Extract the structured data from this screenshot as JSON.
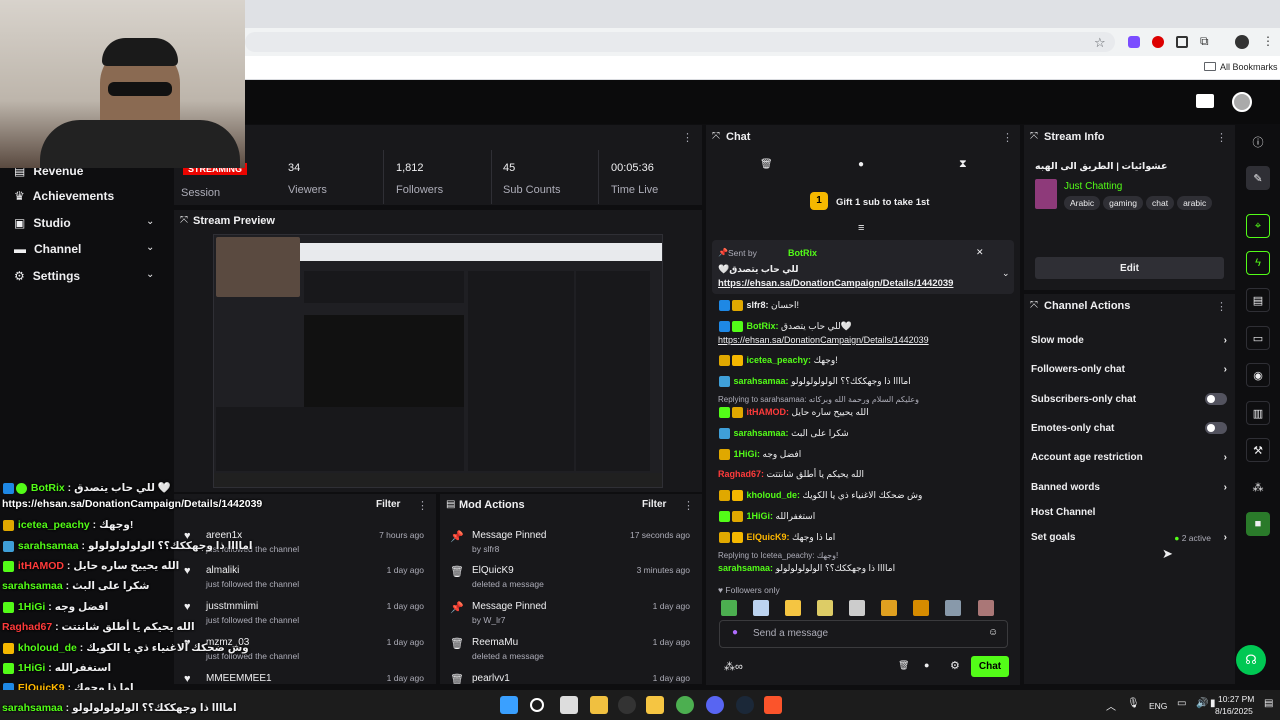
{
  "browser": {
    "all_bookmarks": "All Bookmarks"
  },
  "sidebar": {
    "items": [
      {
        "label": "Revenue"
      },
      {
        "label": "Achievements"
      },
      {
        "label": "Studio"
      },
      {
        "label": "Channel"
      },
      {
        "label": "Settings"
      }
    ]
  },
  "stats": {
    "badge": "STREAMING",
    "session_label": "Session",
    "viewers": {
      "value": "34",
      "label": "Viewers"
    },
    "followers": {
      "value": "1,812",
      "label": "Followers"
    },
    "subs": {
      "value": "45",
      "label": "Sub Counts"
    },
    "time": {
      "value": "00:05:36",
      "label": "Time Live"
    }
  },
  "stream_preview": {
    "title": "Stream Preview"
  },
  "activity": {
    "filter": "Filter",
    "items": [
      {
        "name": "areen1x",
        "sub": "just followed the channel",
        "time": "7 hours ago"
      },
      {
        "name": "almaliki",
        "sub": "just followed the channel",
        "time": "1 day ago"
      },
      {
        "name": "jusstmmiimi",
        "sub": "just followed the channel",
        "time": "1 day ago"
      },
      {
        "name": "mzmz_03",
        "sub": "just followed the channel",
        "time": "1 day ago"
      },
      {
        "name": "MMEEMMEE1",
        "sub": "",
        "time": "1 day ago"
      }
    ]
  },
  "mod_actions": {
    "title": "Mod Actions",
    "filter": "Filter",
    "items": [
      {
        "name": "Message Pinned",
        "sub": "by slfr8",
        "time": "17 seconds ago"
      },
      {
        "name": "ElQuicK9",
        "sub": "deleted a message",
        "time": "3 minutes ago"
      },
      {
        "name": "Message Pinned",
        "sub": "by W_lr7",
        "time": "1 day ago"
      },
      {
        "name": "ReemaMu",
        "sub": "deleted a message",
        "time": "1 day ago"
      },
      {
        "name": "pearlvv1",
        "sub": "",
        "time": "1 day ago"
      }
    ]
  },
  "chat": {
    "title": "Chat",
    "gift": "Gift 1 sub to take 1st",
    "pinned": {
      "sent_by": "Sent by",
      "user": "BotRix",
      "message": "للي حاب يتصدق🤍",
      "link": "https://ehsan.sa/DonationCampaign/Details/1442039"
    },
    "lines": [
      {
        "user": "slfr8:",
        "text": "احسان!",
        "color": "#efeff1"
      },
      {
        "user": "BotRix:",
        "text": "للي حاب يتصدق🤍",
        "color": "#53fc18"
      },
      {
        "user": "",
        "text": "https://ehsan.sa/DonationCampaign/Details/1442039",
        "color": "#efeff1"
      },
      {
        "user": "icetea_peachy:",
        "text": "وجهك!",
        "color": "#53fc18"
      },
      {
        "user": "sarahsamaa:",
        "text": "اماااا ذا وجهككك؟؟ الولولولولولو",
        "color": "#53fc18"
      },
      {
        "user": "",
        "text": "Replying to sarahsamaa: وعليكم السلام ورحمة الله وبركاته",
        "color": "#adadb8"
      },
      {
        "user": "itHAMOD:",
        "text": "الله يحييح ساره حايل",
        "color": "#ff3b3b"
      },
      {
        "user": "sarahsamaa:",
        "text": "شكرا على البث",
        "color": "#53fc18"
      },
      {
        "user": "1HiGi:",
        "text": "افضل وجه",
        "color": "#53fc18"
      },
      {
        "user": "Raghad67:",
        "text": "الله يحيكم يا أطلق شانتتت",
        "color": "#ff3b3b"
      },
      {
        "user": "kholoud_de:",
        "text": "وش ضحكك الاغنياء ذي يا الكويك",
        "color": "#53fc18"
      },
      {
        "user": "1HiGi:",
        "text": "استغفرالله",
        "color": "#53fc18"
      },
      {
        "user": "ElQuicK9:",
        "text": "اما ذا وجهك",
        "color": "#ffb800"
      },
      {
        "user": "",
        "text": "Replying to Icetea_peachy: وجهك!",
        "color": "#adadb8"
      },
      {
        "user": "sarahsamaa:",
        "text": "اماااا ذا وجهككك؟؟ الولولولولولو",
        "color": "#53fc18"
      }
    ],
    "followers_only": "Followers only",
    "placeholder": "Send a message",
    "send": "Chat"
  },
  "stream_info": {
    "title": "Stream Info",
    "stream_title": "عشوائيات | الطريق الى الهبه",
    "category": "Just Chatting",
    "tags": [
      "Arabic",
      "gaming",
      "chat",
      "arabic"
    ],
    "edit": "Edit"
  },
  "channel_actions": {
    "title": "Channel Actions",
    "items": [
      {
        "label": "Slow mode"
      },
      {
        "label": "Followers-only chat"
      },
      {
        "label": "Subscribers-only chat"
      },
      {
        "label": "Emotes-only chat"
      },
      {
        "label": "Account age restriction"
      },
      {
        "label": "Banned words"
      },
      {
        "label": "Host Channel"
      },
      {
        "label": "Set goals"
      }
    ],
    "goals_status": "2 active"
  },
  "overlay_chat": [
    {
      "user": "BotRix",
      "text": "للي حاب يتصدق 🤍",
      "color": "#53fc18"
    },
    {
      "user": "",
      "text": "https://ehsan.sa/DonationCampaign/Details/1442039",
      "color": "#ffffff"
    },
    {
      "user": "icetea_peachy",
      "text": "وجهك!",
      "color": "#53fc18"
    },
    {
      "user": "sarahsamaa",
      "text": "اماااا ذا وجهككك؟؟ الولولولولولو",
      "color": "#53fc18"
    },
    {
      "user": "itHAMOD",
      "text": "الله يحييح ساره حايل",
      "color": "#ff3b3b"
    },
    {
      "user": "sarahsamaa",
      "text": "شكرا على البث",
      "color": "#53fc18"
    },
    {
      "user": "1HiGi",
      "text": "افضل وجه",
      "color": "#53fc18"
    },
    {
      "user": "Raghad67",
      "text": "الله يحيكم يا أطلق شانتتت",
      "color": "#ff3b3b"
    },
    {
      "user": "kholoud_de",
      "text": "وش ضحكك الاغنياء ذي يا الكويك",
      "color": "#53fc18"
    },
    {
      "user": "1HiGi",
      "text": "استغفرالله",
      "color": "#53fc18"
    },
    {
      "user": "ElQuicK9",
      "text": "اما ذا وجهك",
      "color": "#ffb800"
    },
    {
      "user": "sarahsamaa",
      "text": "اماااا ذا وجهككك؟؟ الولولولولولو",
      "color": "#53fc18"
    }
  ],
  "taskbar": {
    "lang": "ENG",
    "time": "10:27 PM",
    "date": "8/16/2025"
  },
  "colors": {
    "accent": "#53fc18",
    "bg": "#0e0e10",
    "panel": "#18181b"
  }
}
